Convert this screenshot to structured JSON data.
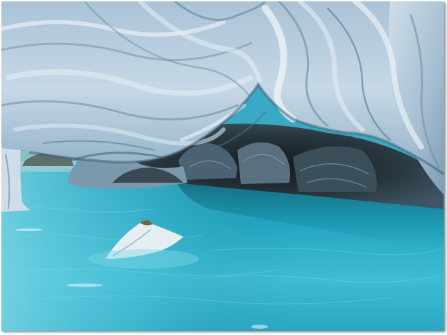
{
  "scene": {
    "subject": "marble-cave",
    "colors": {
      "water_light": "#6fd3e6",
      "water_mid": "#2fb0c8",
      "water_deep": "#13798f",
      "marble_light": "#dbe7ef",
      "marble_mid": "#9fb9cc",
      "marble_dark": "#5f7d94",
      "cave_shadow": "#1d2a30",
      "frame": "#ffffff"
    }
  }
}
